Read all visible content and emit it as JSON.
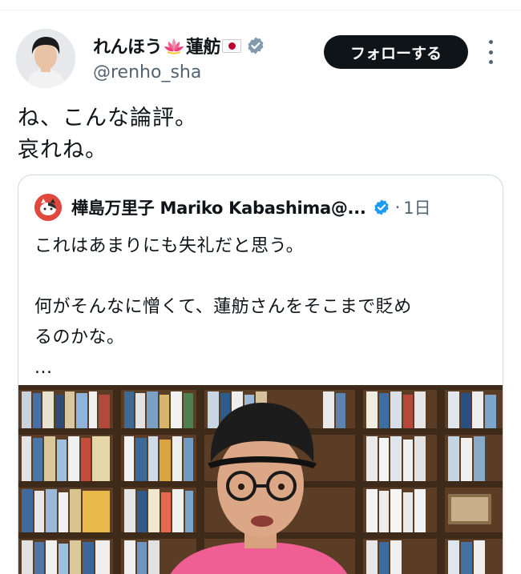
{
  "post": {
    "display_name": "れんほう",
    "display_name_suffix": "蓮舫",
    "handle": "@renho_sha",
    "follow_label": "フォローする",
    "text_line1": "ね、こんな論評。",
    "text_line2": "哀れね。"
  },
  "quote": {
    "author": "樺島万里子 Mariko Kabashima@...",
    "separator": "·",
    "time": "1日",
    "line1": "これはあまりにも失礼だと思う。",
    "line2": "何がそんなに憎くて、蓮舫さんをそこまで貶め",
    "line3": "るのかな。",
    "line4": "..."
  },
  "icons": {
    "lotus": "lotus-emoji-icon",
    "flag": "japan-flag-icon",
    "verified_color": "#829aab",
    "quote_verified_color": "#1d9bf0"
  },
  "colors": {
    "text": "#0f1419",
    "secondary": "#536471",
    "border": "#cfd9de",
    "button_bg": "#0f1419"
  }
}
